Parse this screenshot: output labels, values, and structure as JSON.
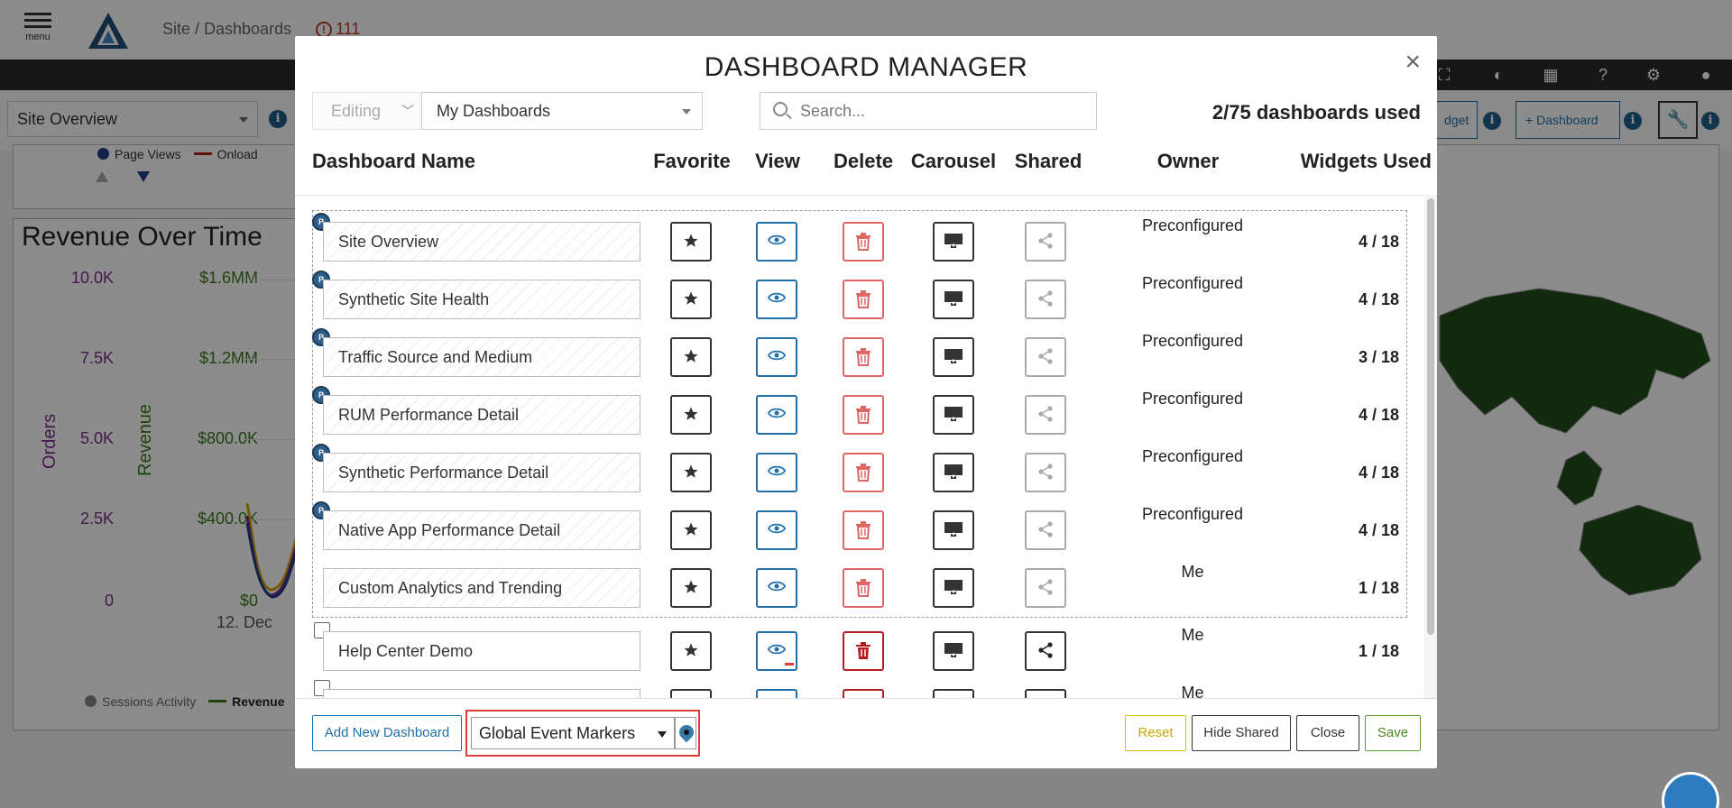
{
  "app": {
    "menu_label": "menu",
    "breadcrumb": "Site / Dashboards",
    "alert_count": "111",
    "site_selector": "Site Overview",
    "add_widget_label": "dget",
    "add_dashboard_label": "+ Dashboard"
  },
  "background": {
    "legend_top": [
      {
        "label": "Page Views",
        "color": "#1f3c88"
      },
      {
        "label": "Onload",
        "color": "#b71c1c"
      }
    ],
    "chart_title": "Revenue Over Time",
    "orders_axis": {
      "label": "Orders",
      "ticks": [
        "10.0K",
        "7.5K",
        "5.0K",
        "2.5K",
        "0"
      ]
    },
    "revenue_axis": {
      "label": "Revenue",
      "ticks": [
        "$1.6MM",
        "$1.2MM",
        "$800.0K",
        "$400.0K",
        "$0"
      ]
    },
    "x_tick": "12. Dec",
    "legend_bottom": [
      {
        "label": "Sessions Activity",
        "color": "#888888"
      },
      {
        "label": "Revenue",
        "color": "#3a7a1a"
      }
    ]
  },
  "modal": {
    "title": "DASHBOARD MANAGER",
    "close_glyph": "×",
    "mode": "Editing",
    "dashboard_filter": "My Dashboards",
    "search_placeholder": "Search...",
    "usage": "2/75 dashboards used",
    "columns": {
      "name": "Dashboard Name",
      "favorite": "Favorite",
      "view": "View",
      "delete": "Delete",
      "carousel": "Carousel",
      "shared": "Shared",
      "owner": "Owner",
      "widgets": "Widgets Used"
    },
    "preset_badge": "P",
    "rows": [
      {
        "name": "Site Overview",
        "owner": "Preconfigured",
        "widgets": "4 / 18",
        "preset": true
      },
      {
        "name": "Synthetic Site Health",
        "owner": "Preconfigured",
        "widgets": "4 / 18",
        "preset": true
      },
      {
        "name": "Traffic Source and Medium",
        "owner": "Preconfigured",
        "widgets": "3 / 18",
        "preset": true
      },
      {
        "name": "RUM Performance Detail",
        "owner": "Preconfigured",
        "widgets": "4 / 18",
        "preset": true
      },
      {
        "name": "Synthetic Performance Detail",
        "owner": "Preconfigured",
        "widgets": "4 / 18",
        "preset": true
      },
      {
        "name": "Native App Performance Detail",
        "owner": "Preconfigured",
        "widgets": "4 / 18",
        "preset": true
      },
      {
        "name": "Custom Analytics and Trending",
        "owner": "Me",
        "widgets": "1 / 18",
        "preset": false
      },
      {
        "name": "Help Center Demo",
        "owner": "Me",
        "widgets": "1 / 18",
        "preset": false
      },
      {
        "name": "",
        "owner": "Me",
        "widgets": "",
        "preset": false
      }
    ],
    "footer": {
      "add_new": "Add New Dashboard",
      "event_markers": "Global Event Markers",
      "reset": "Reset",
      "hide_shared": "Hide Shared",
      "close": "Close",
      "save": "Save"
    }
  }
}
